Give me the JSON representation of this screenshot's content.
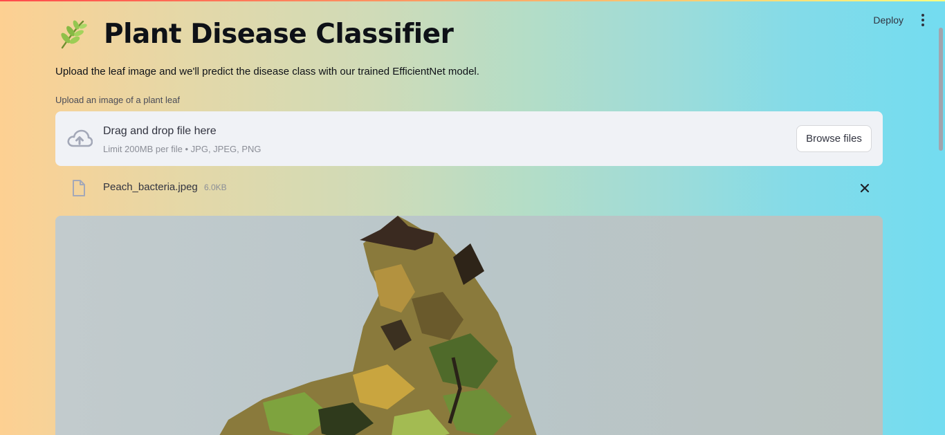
{
  "header": {
    "deploy_label": "Deploy",
    "menu_icon": "kebab-menu-icon"
  },
  "page": {
    "title_icon": "leaf-herb-icon",
    "title": "Plant Disease Classifier",
    "subtitle": "Upload the leaf image and we'll predict the disease class with our trained EfficientNet model."
  },
  "uploader": {
    "label": "Upload an image of a plant leaf",
    "drop_text": "Drag and drop file here",
    "limit_text": "Limit 200MB per file • JPG, JPEG, PNG",
    "browse_label": "Browse files",
    "upload_icon": "cloud-upload-icon"
  },
  "uploaded_file": {
    "name": "Peach_bacteria.jpeg",
    "size": "6.0KB",
    "file_icon": "file-icon",
    "remove_icon": "close-icon"
  },
  "preview": {
    "description_icon": "leaf-image"
  },
  "colors": {
    "accent_start": "#ff4b4b",
    "accent_end": "#fffd80",
    "dropzone_bg": "#f0f2f6",
    "text": "#31333f"
  }
}
